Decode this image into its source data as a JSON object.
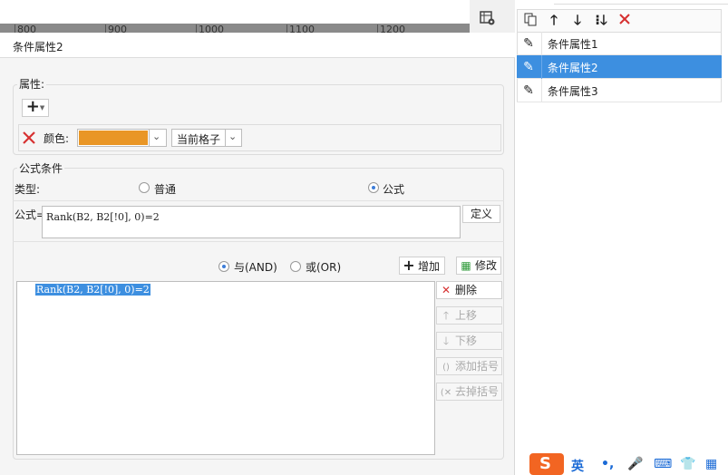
{
  "ruler": {
    "ticks": [
      "800",
      "900",
      "1000",
      "1100",
      "1200"
    ]
  },
  "dialog": {
    "title": "条件属性2",
    "attributes": {
      "legend": "属性:",
      "add_symbol": "+",
      "color_label": "颜色:",
      "color_value": "#e99626",
      "scope_value": "当前格子"
    },
    "formula_condition": {
      "legend": "公式条件",
      "type_label": "类型:",
      "type_options": [
        "普通",
        "公式"
      ],
      "type_selected": "公式",
      "formula_label": "公式=",
      "formula_value": "Rank(B2, B2[!0], 0)=2",
      "define_button": "定义",
      "logic_options": [
        "与(AND)",
        "或(OR)"
      ],
      "logic_selected": "与(AND)",
      "add_button": "增加",
      "modify_button": "修改",
      "conditions": [
        "Rank(B2, B2[!0], 0)=2"
      ],
      "side_buttons": {
        "delete": "删除",
        "move_up": "上移",
        "move_down": "下移",
        "add_brackets": "添加括号",
        "remove_brackets": "去掉括号"
      }
    }
  },
  "right_panel": {
    "items": [
      "条件属性1",
      "条件属性2",
      "条件属性3"
    ],
    "selected": "条件属性2"
  },
  "ime": {
    "label": "英"
  }
}
